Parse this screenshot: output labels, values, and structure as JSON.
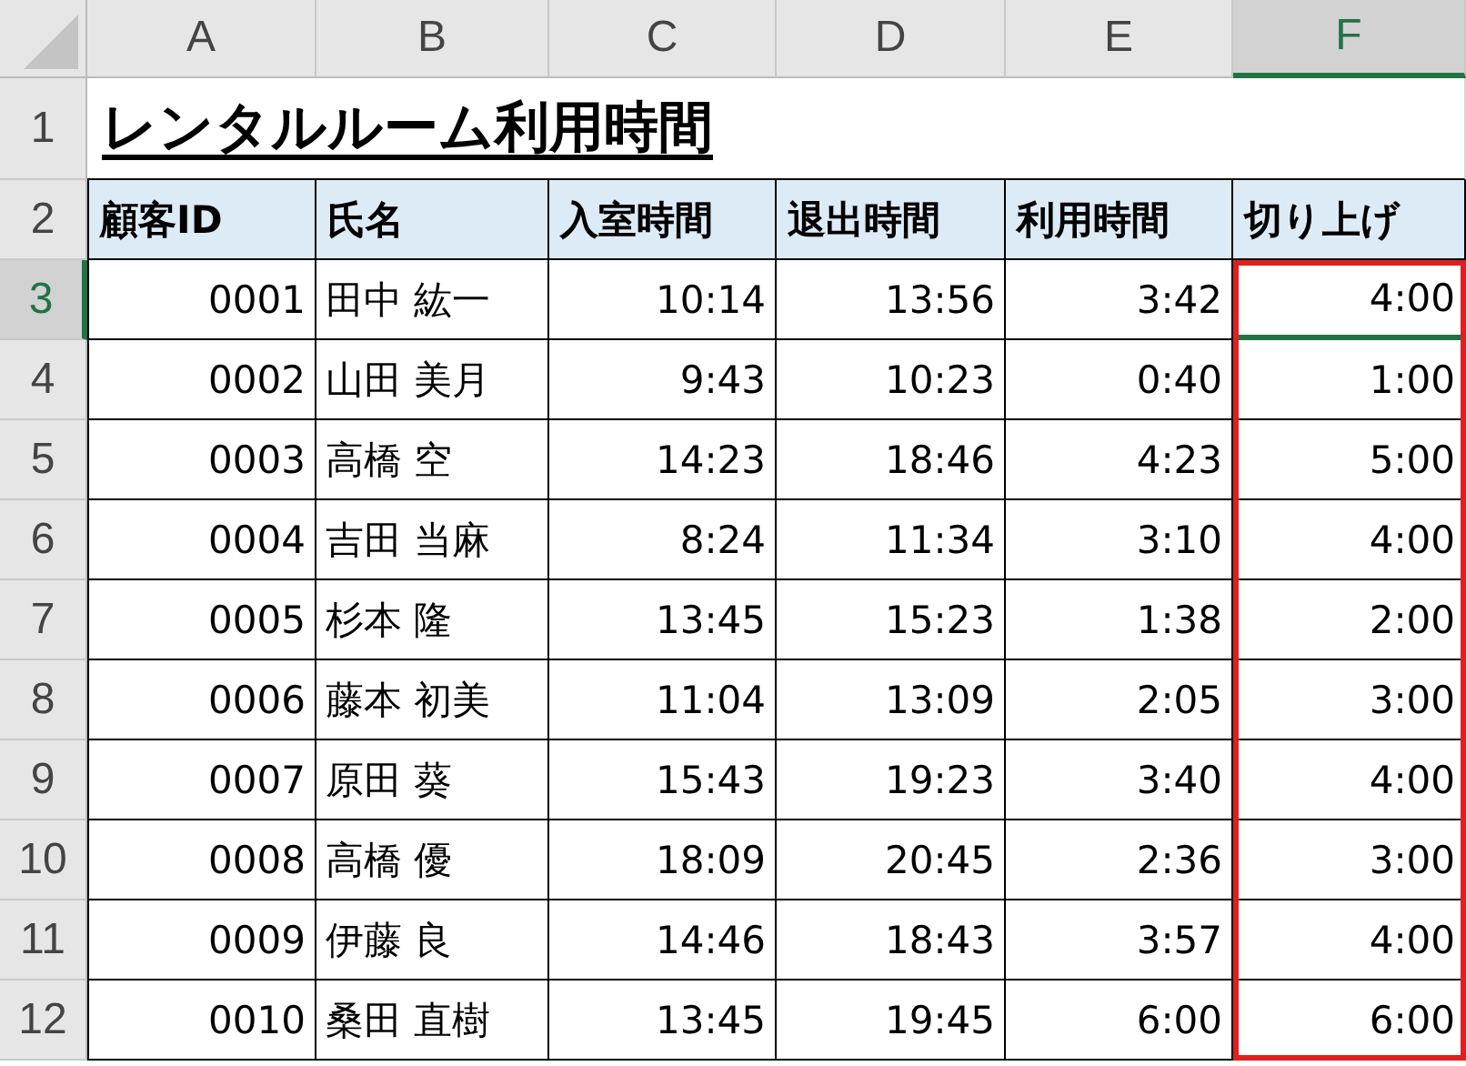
{
  "columns": [
    {
      "letter": "A",
      "selected": false,
      "highlighted": false
    },
    {
      "letter": "B",
      "selected": false,
      "highlighted": false
    },
    {
      "letter": "C",
      "selected": false,
      "highlighted": false
    },
    {
      "letter": "D",
      "selected": false,
      "highlighted": false
    },
    {
      "letter": "E",
      "selected": false,
      "highlighted": false
    },
    {
      "letter": "F",
      "selected": true,
      "highlighted": true
    }
  ],
  "title": "レンタルルーム利用時間",
  "title_row": {
    "number": "1",
    "selected": false
  },
  "header_row": {
    "number": "2",
    "selected": false,
    "cells": [
      "顧客ID",
      "氏名",
      "入室時間",
      "退出時間",
      "利用時間",
      "切り上げ"
    ]
  },
  "rows": [
    {
      "number": "3",
      "selected": true,
      "id": "0001",
      "name": "田中 紘一",
      "entry": "10:14",
      "exit": "13:56",
      "usage": "3:42",
      "rounded": "4:00"
    },
    {
      "number": "4",
      "selected": false,
      "id": "0002",
      "name": "山田 美月",
      "entry": "9:43",
      "exit": "10:23",
      "usage": "0:40",
      "rounded": "1:00"
    },
    {
      "number": "5",
      "selected": false,
      "id": "0003",
      "name": "高橋 空",
      "entry": "14:23",
      "exit": "18:46",
      "usage": "4:23",
      "rounded": "5:00"
    },
    {
      "number": "6",
      "selected": false,
      "id": "0004",
      "name": "吉田 当麻",
      "entry": "8:24",
      "exit": "11:34",
      "usage": "3:10",
      "rounded": "4:00"
    },
    {
      "number": "7",
      "selected": false,
      "id": "0005",
      "name": "杉本 隆",
      "entry": "13:45",
      "exit": "15:23",
      "usage": "1:38",
      "rounded": "2:00"
    },
    {
      "number": "8",
      "selected": false,
      "id": "0006",
      "name": "藤本 初美",
      "entry": "11:04",
      "exit": "13:09",
      "usage": "2:05",
      "rounded": "3:00"
    },
    {
      "number": "9",
      "selected": false,
      "id": "0007",
      "name": "原田 葵",
      "entry": "15:43",
      "exit": "19:23",
      "usage": "3:40",
      "rounded": "4:00"
    },
    {
      "number": "10",
      "selected": false,
      "id": "0008",
      "name": "高橋 優",
      "entry": "18:09",
      "exit": "20:45",
      "usage": "2:36",
      "rounded": "3:00"
    },
    {
      "number": "11",
      "selected": false,
      "id": "0009",
      "name": "伊藤 良",
      "entry": "14:46",
      "exit": "18:43",
      "usage": "3:57",
      "rounded": "4:00"
    },
    {
      "number": "12",
      "selected": false,
      "id": "0010",
      "name": "桑田 直樹",
      "entry": "13:45",
      "exit": "19:45",
      "usage": "6:00",
      "rounded": "6:00"
    }
  ]
}
